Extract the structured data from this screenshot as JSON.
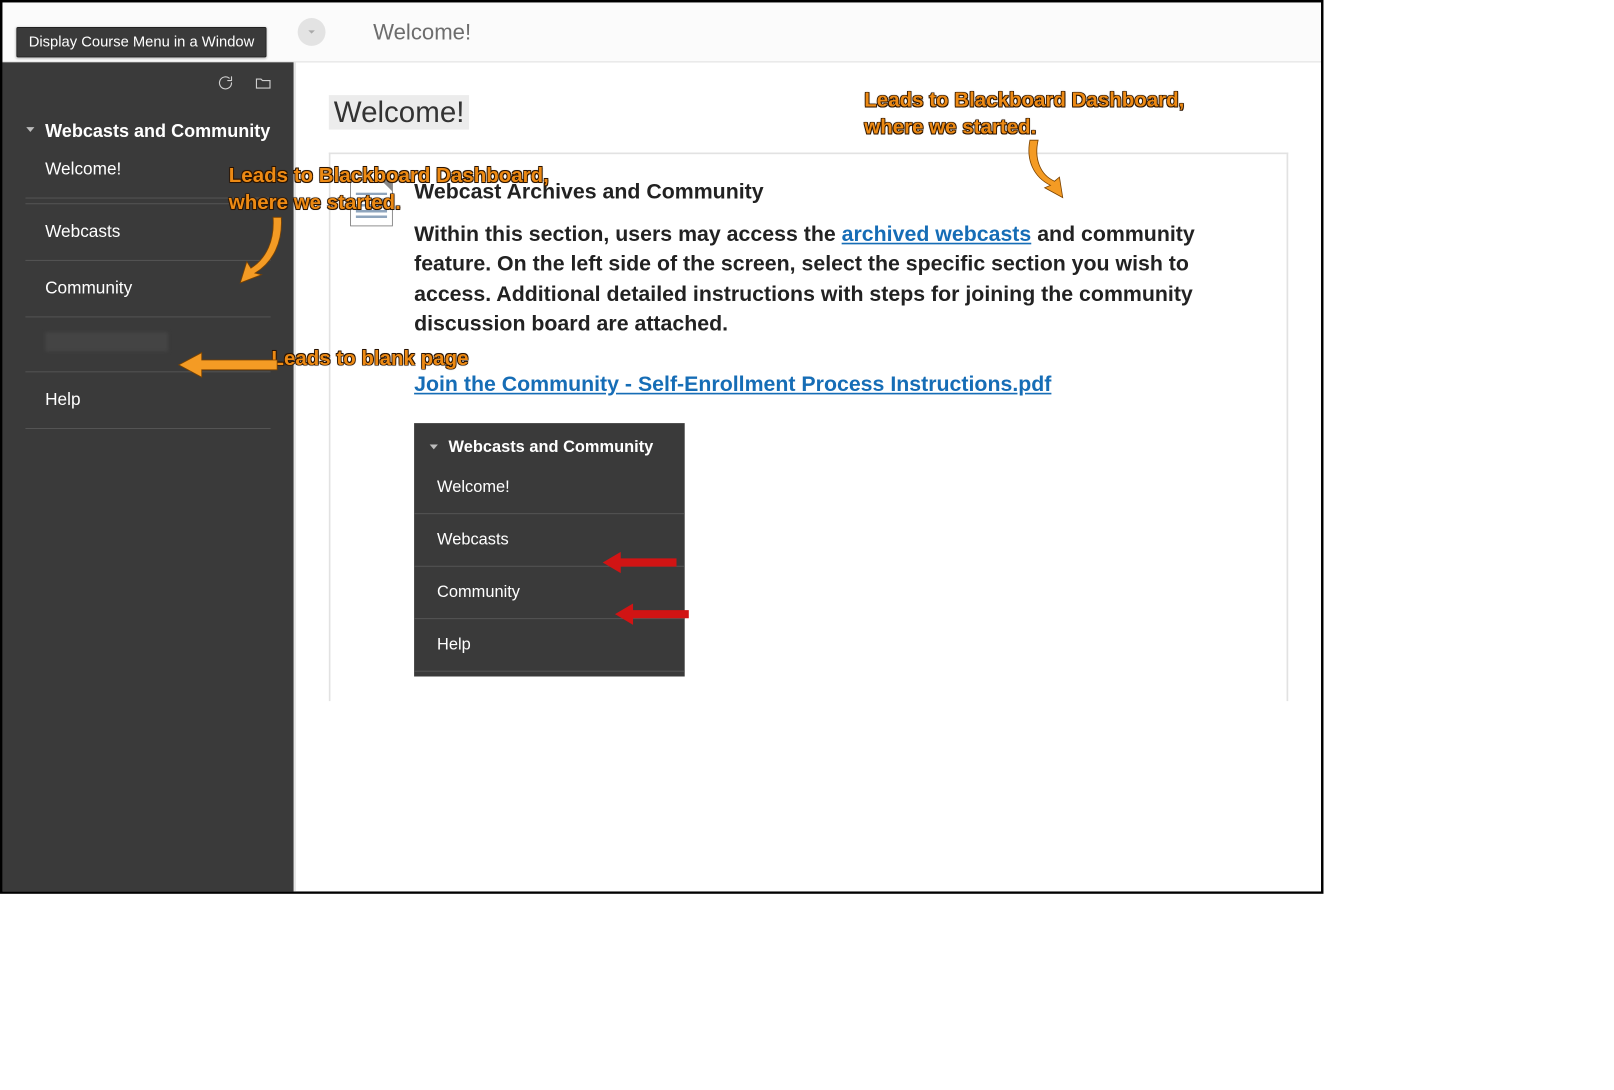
{
  "tooltip": "Display Course Menu in a Window",
  "breadcrumb": "Welcome!",
  "sidebar": {
    "title": "Webcasts and Community",
    "items": [
      "Welcome!",
      "Webcasts",
      "Community",
      "",
      "Help"
    ]
  },
  "page": {
    "title": "Welcome!",
    "entry_heading": "Webcast Archives and Community",
    "body_before": "Within this section, users may access the ",
    "link_text": "archived webcasts",
    "body_after": " and community feature. On the left side of the screen, select the specific section you wish to access. Additional detailed instructions with steps for joining the community discussion board are attached.",
    "pdf_link": "Join the Community - Self-Enrollment Process Instructions.pdf"
  },
  "mini": {
    "title": "Webcasts and Community",
    "items": [
      "Welcome!",
      "Webcasts",
      "Community",
      "Help"
    ]
  },
  "annotations": {
    "a1": "Leads to Blackboard Dashboard, where we started.",
    "a2": "Leads to Blackboard Dashboard, where we started.",
    "a3": "Leads to blank page"
  }
}
